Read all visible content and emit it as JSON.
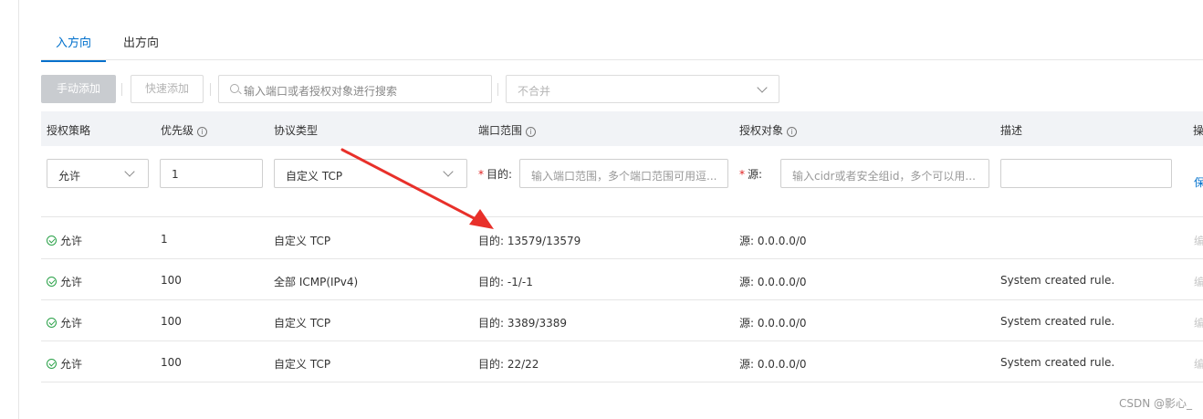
{
  "tabs": [
    {
      "label": "入方向",
      "active": true
    },
    {
      "label": "出方向",
      "active": false
    }
  ],
  "toolbar": {
    "manual_add": "手动添加",
    "quick_add": "快速添加",
    "search_placeholder": "输入端口或者授权对象进行搜索",
    "merge_value": "不合并"
  },
  "table": {
    "headers": [
      "授权策略",
      "优先级",
      "协议类型",
      "端口范围",
      "授权对象",
      "描述",
      "操"
    ],
    "edit_row": {
      "policy": "允许",
      "priority": "1",
      "protocol": "自定义 TCP",
      "dest_label": "目的:",
      "dest_placeholder": "输入端口范围，多个端口范围可用逗...",
      "source_label": "源:",
      "source_placeholder": "输入cidr或者安全组id，多个可以用...",
      "description": "",
      "action": "保"
    },
    "rows": [
      {
        "policy": "允许",
        "priority": "1",
        "protocol": "自定义 TCP",
        "port": "目的: 13579/13579",
        "source": "源: 0.0.0.0/0",
        "description": "",
        "action": "编"
      },
      {
        "policy": "允许",
        "priority": "100",
        "protocol": "全部 ICMP(IPv4)",
        "port": "目的: -1/-1",
        "source": "源: 0.0.0.0/0",
        "description": "System created rule.",
        "action": "编"
      },
      {
        "policy": "允许",
        "priority": "100",
        "protocol": "自定义 TCP",
        "port": "目的: 3389/3389",
        "source": "源: 0.0.0.0/0",
        "description": "System created rule.",
        "action": "编"
      },
      {
        "policy": "允许",
        "priority": "100",
        "protocol": "自定义 TCP",
        "port": "目的: 22/22",
        "source": "源: 0.0.0.0/0",
        "description": "System created rule.",
        "action": "编"
      }
    ]
  },
  "watermark": "CSDN @影心_",
  "colors": {
    "accent": "#0070cc",
    "allow": "#2aa148",
    "arrow": "#e8302a",
    "required": "#e02020"
  },
  "icons": {
    "status": "check-circle-icon",
    "info": "info-icon",
    "search": "search-icon",
    "dropdown": "chevron-down-icon"
  }
}
